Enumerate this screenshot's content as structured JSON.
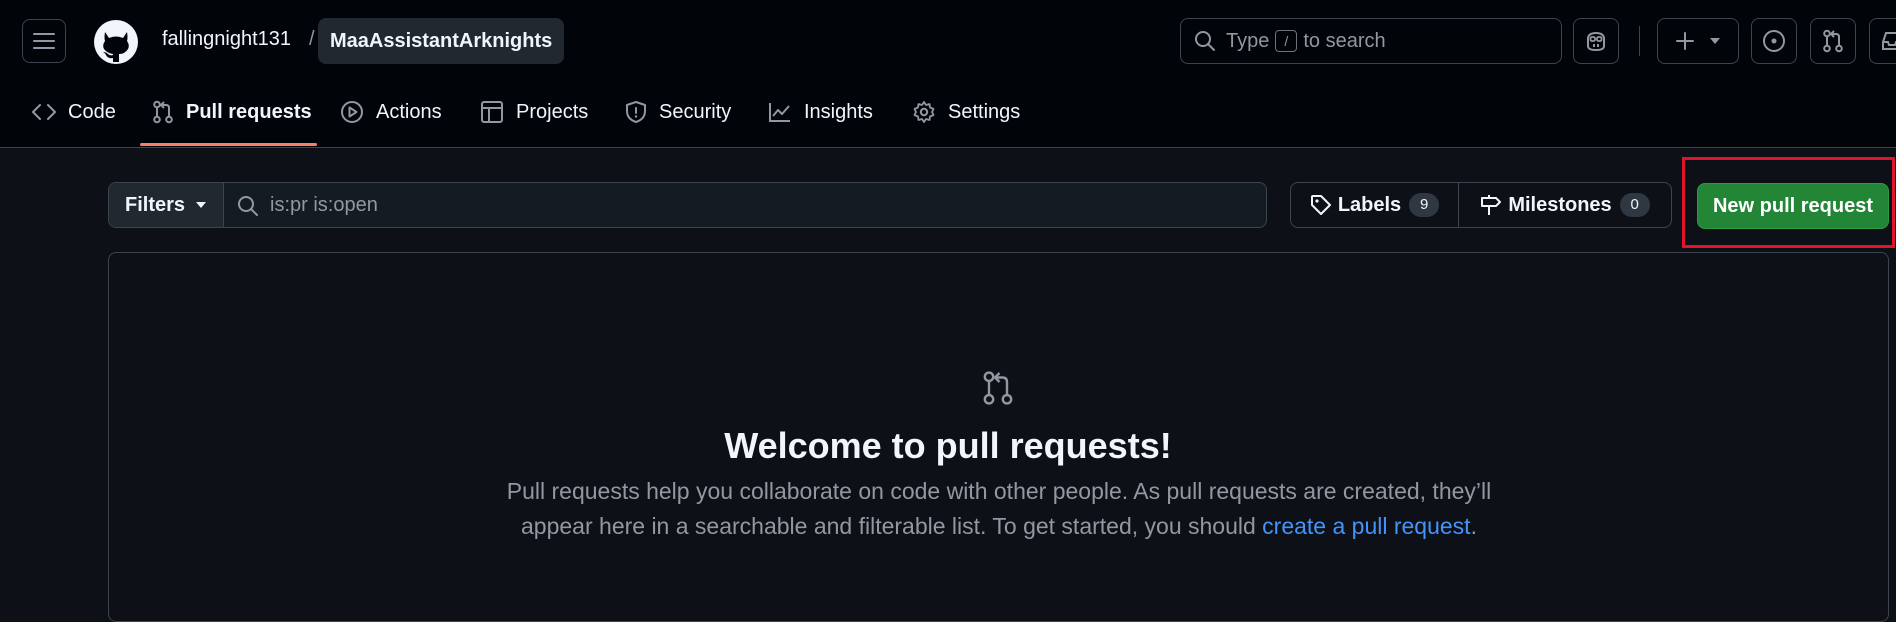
{
  "header": {
    "owner": "fallingnight131",
    "separator": "/",
    "repo": "MaaAssistantArknights",
    "search": {
      "prefix": "Type",
      "key": "/",
      "suffix": "to search"
    }
  },
  "tabs": [
    {
      "label": "Code",
      "icon": "code-icon"
    },
    {
      "label": "Pull requests",
      "icon": "git-pull-request-icon",
      "active": true
    },
    {
      "label": "Actions",
      "icon": "play-icon"
    },
    {
      "label": "Projects",
      "icon": "table-icon"
    },
    {
      "label": "Security",
      "icon": "shield-icon"
    },
    {
      "label": "Insights",
      "icon": "graph-icon"
    },
    {
      "label": "Settings",
      "icon": "gear-icon"
    }
  ],
  "toolbar": {
    "filters_label": "Filters",
    "search_placeholder": "is:pr is:open",
    "labels_label": "Labels",
    "labels_count": "9",
    "milestones_label": "Milestones",
    "milestones_count": "0",
    "new_pr_label": "New pull request"
  },
  "blankslate": {
    "title": "Welcome to pull requests!",
    "desc_part1": "Pull requests help you collaborate on code with other people. As pull requests are created, they’ll appear here in a searchable and filterable list. To get started, you should ",
    "desc_link": "create a pull request",
    "desc_part2": "."
  },
  "colors": {
    "background": "#0d1117",
    "header": "#010409",
    "accent_underline": "#f78166",
    "primary_button": "#238636",
    "link": "#4493f8",
    "highlight_box": "#e0142c"
  }
}
